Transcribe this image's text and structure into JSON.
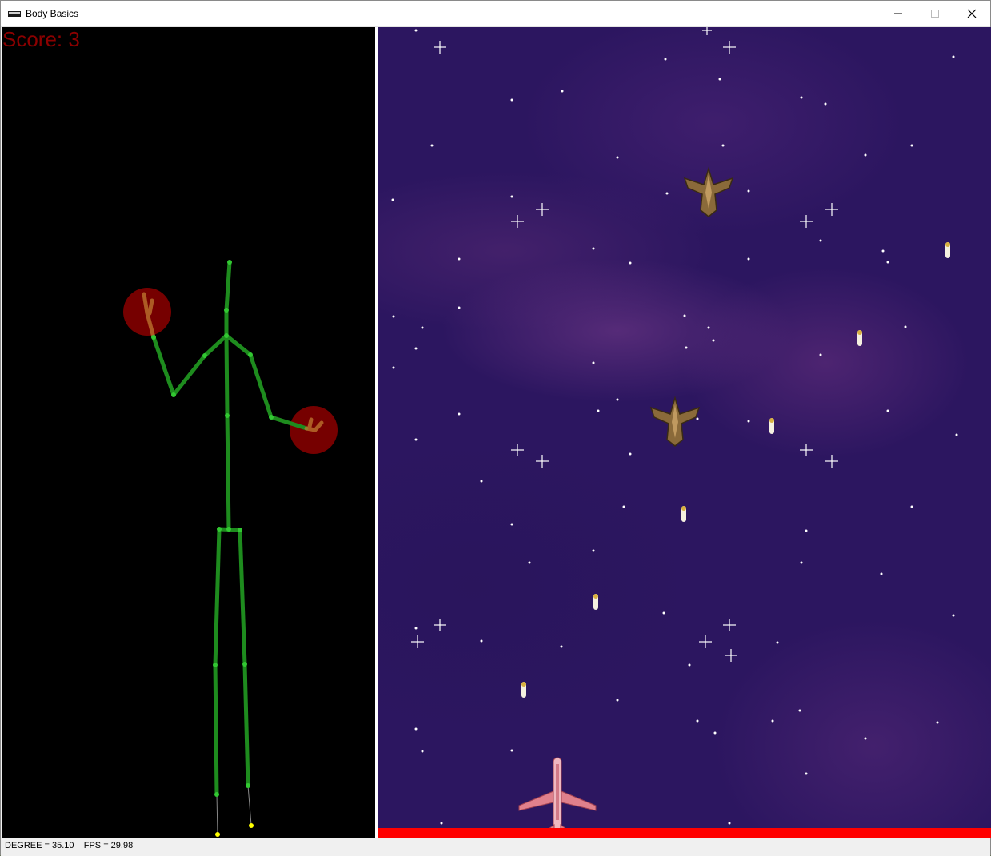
{
  "window": {
    "title": "Body Basics"
  },
  "skeleton_view": {
    "score_text": "Score: 3",
    "score_color": "#8b0000",
    "bone_color": "#1e8c1e",
    "joint_color": "#32c832",
    "hand_circle_color": "#8b0000",
    "foot_marker_color": "#ffff00"
  },
  "game_view": {
    "player": "airplane-icon",
    "enemies": [
      "fighter-jet-icon",
      "fighter-jet-icon"
    ],
    "bullets_count": 6,
    "health_bar_color": "#ff0000"
  },
  "status_bar": {
    "text": "DEGREE = 35.10    FPS = 29.98"
  }
}
